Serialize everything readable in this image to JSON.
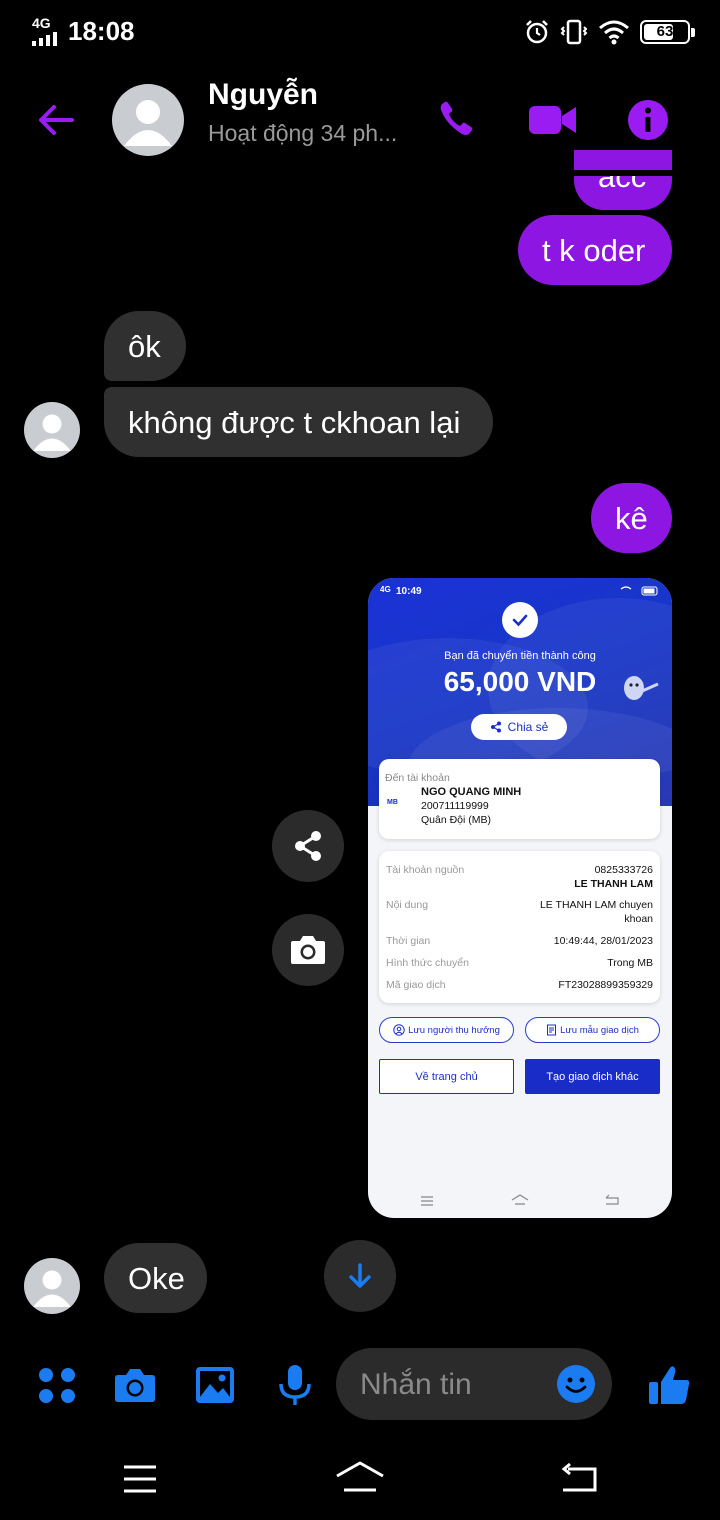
{
  "status_bar": {
    "network": "4G",
    "time": "18:08",
    "battery": "63"
  },
  "header": {
    "contact_name": "Nguyễn",
    "contact_status": "Hoạt động 34 ph..."
  },
  "messages": [
    {
      "from": "me",
      "text": "acc"
    },
    {
      "from": "me",
      "text": "t k oder"
    },
    {
      "from": "them",
      "text": "ôk"
    },
    {
      "from": "them",
      "text": "không được t ckhoan lại"
    },
    {
      "from": "me",
      "text": "kê"
    },
    {
      "from": "them",
      "text": "Oke"
    }
  ],
  "transfer_screenshot": {
    "status_time": "10:49",
    "status_network": "4G",
    "status_battery": "88",
    "success_text": "Bạn đã chuyển tiền thành công",
    "amount": "65,000 VND",
    "share_label": "Chia sẻ",
    "to_account_label": "Đến tài khoản",
    "bank_logo": "MB",
    "recipient_name": "NGO QUANG MINH",
    "recipient_account": "200711119999",
    "recipient_bank": "Quân Đội (MB)",
    "details": [
      {
        "key": "Tài khoản nguồn",
        "value": "0825333726",
        "value2": "LE THANH LAM"
      },
      {
        "key": "Nội dung",
        "value": "LE THANH LAM chuyen",
        "value2": "khoan"
      },
      {
        "key": "Thời gian",
        "value": "10:49:44, 28/01/2023"
      },
      {
        "key": "Hình thức chuyển",
        "value": "Trong MB"
      },
      {
        "key": "Mã giao dịch",
        "value": "FT23028899359329"
      }
    ],
    "save_beneficiary": "Lưu người thụ hưởng",
    "save_template": "Lưu mẫu giao dịch",
    "home_button": "Về trang chủ",
    "new_transaction_button": "Tạo giao dịch khác"
  },
  "composer": {
    "placeholder": "Nhắn tin"
  },
  "colors": {
    "accent": "#9b1cf2",
    "outgoing_bubble": "#8e16e3",
    "incoming_bubble": "#303030",
    "composer_blue": "#1a7cf0"
  }
}
